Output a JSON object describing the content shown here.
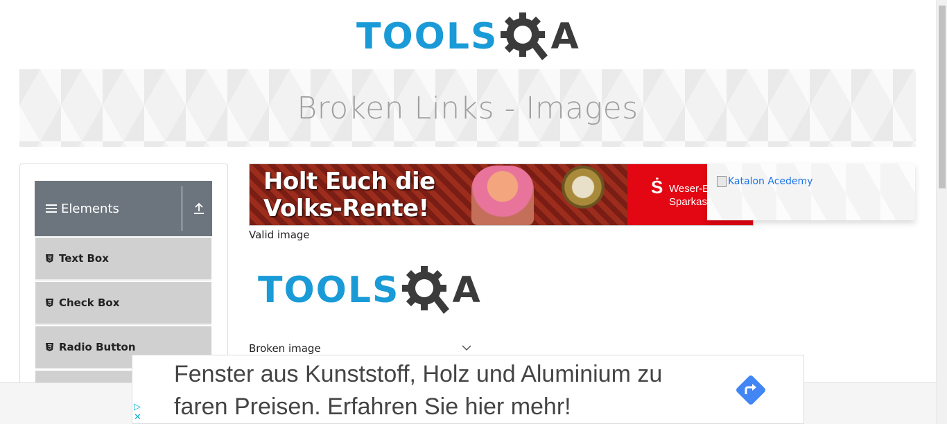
{
  "header": {
    "logo_text": "TOOLS",
    "logo_suffix": "A"
  },
  "banner": {
    "title": "Broken Links - Images"
  },
  "sidebar": {
    "group_label": "Elements",
    "items": [
      {
        "label": "Text Box"
      },
      {
        "label": "Check Box"
      },
      {
        "label": "Radio Button"
      }
    ]
  },
  "ad_image": {
    "headline_line1": "Holt Euch die",
    "headline_line2": "Volks-Rente!",
    "bank_line1": "Weser-E",
    "bank_line2": "Sparkas",
    "s_logo": "Ṡ"
  },
  "katalon": {
    "alt_text": "Katalon Acedemy"
  },
  "main": {
    "valid_caption": "Valid image",
    "broken_caption": "Broken image",
    "logo_text": "TOOLS",
    "logo_suffix": "A"
  },
  "bottom_ad": {
    "text": "Fenster aus Kunststoff, Holz und Aluminium zu faren Preisen. Erfahren Sie hier mehr!",
    "adchoice_play": "▷",
    "adchoice_close": "✕"
  },
  "colors": {
    "brand_blue": "#1a9bd7",
    "brand_dark": "#3b3b3b",
    "sidebar_header": "#6c757d",
    "menu_item_bg": "#d0d0d0",
    "sparkasse_red": "#e30613",
    "go_blue": "#4285f4"
  }
}
